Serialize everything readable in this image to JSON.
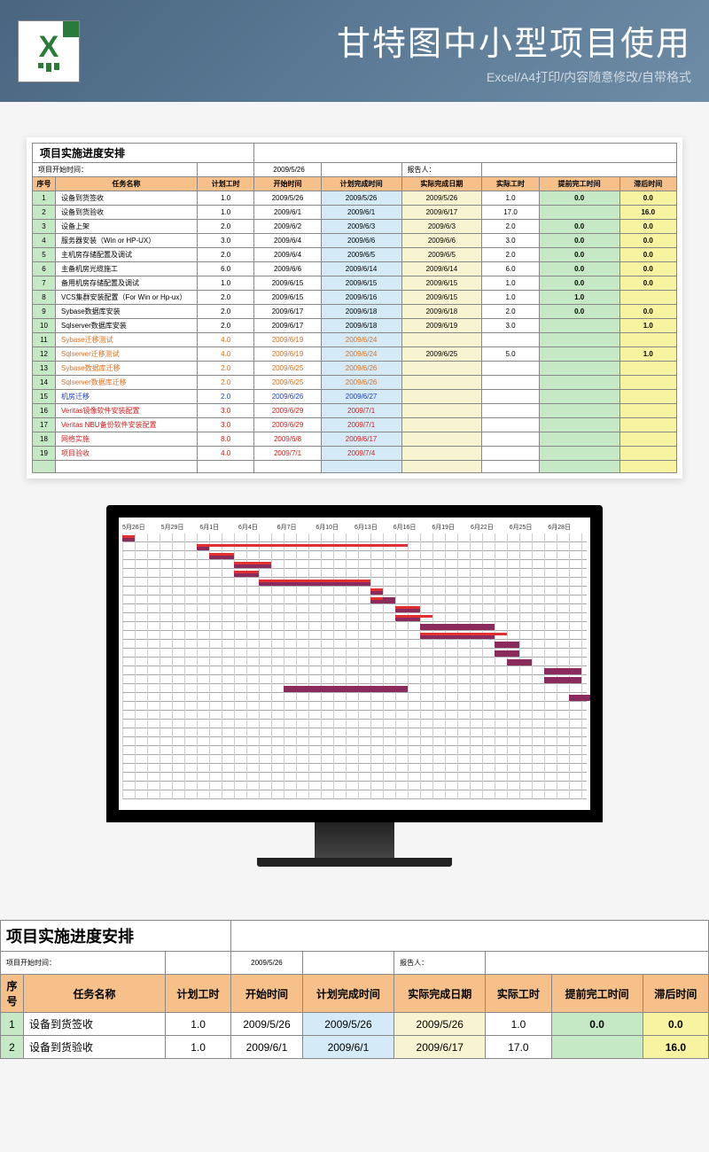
{
  "banner": {
    "title": "甘特图中小型项目使用",
    "subtitle": "Excel/A4打印/内容随意修改/自带格式"
  },
  "sheet": {
    "title": "项目实施进度安排",
    "start_label": "项目开始时间：",
    "start_date": "2009/5/26",
    "reporter_label": "报告人：",
    "headers": {
      "seq": "序号",
      "name": "任务名称",
      "plan_hours": "计划工时",
      "start": "开始时间",
      "plan_end": "计划完成时间",
      "actual_end": "实际完成日期",
      "actual_hours": "实际工时",
      "early": "提前完工时间",
      "late": "滞后时间"
    },
    "rows": [
      {
        "seq": "1",
        "name": "设备到货签收",
        "ph": "1.0",
        "st": "2009/5/26",
        "pe": "2009/5/26",
        "ae": "2009/5/26",
        "ah": "1.0",
        "early": "0.0",
        "late": "0.0",
        "cls": ""
      },
      {
        "seq": "2",
        "name": "设备到货验收",
        "ph": "1.0",
        "st": "2009/6/1",
        "pe": "2009/6/1",
        "ae": "2009/6/17",
        "ah": "17.0",
        "early": "",
        "late": "16.0",
        "cls": ""
      },
      {
        "seq": "3",
        "name": "设备上架",
        "ph": "2.0",
        "st": "2009/6/2",
        "pe": "2009/6/3",
        "ae": "2009/6/3",
        "ah": "2.0",
        "early": "0.0",
        "late": "0.0",
        "cls": ""
      },
      {
        "seq": "4",
        "name": "服务器安装（Win or HP-UX）",
        "ph": "3.0",
        "st": "2009/6/4",
        "pe": "2009/6/6",
        "ae": "2009/6/6",
        "ah": "3.0",
        "early": "0.0",
        "late": "0.0",
        "cls": ""
      },
      {
        "seq": "5",
        "name": "主机房存储配置及调试",
        "ph": "2.0",
        "st": "2009/6/4",
        "pe": "2009/6/5",
        "ae": "2009/6/5",
        "ah": "2.0",
        "early": "0.0",
        "late": "0.0",
        "cls": ""
      },
      {
        "seq": "6",
        "name": "主备机房光缆施工",
        "ph": "6.0",
        "st": "2009/6/6",
        "pe": "2009/6/14",
        "ae": "2009/6/14",
        "ah": "6.0",
        "early": "0.0",
        "late": "0.0",
        "cls": ""
      },
      {
        "seq": "7",
        "name": "备用机房存储配置及调试",
        "ph": "1.0",
        "st": "2009/6/15",
        "pe": "2009/6/15",
        "ae": "2009/6/15",
        "ah": "1.0",
        "early": "0.0",
        "late": "0.0",
        "cls": ""
      },
      {
        "seq": "8",
        "name": "VCS集群安装配置（For Win or Hp-ux）",
        "ph": "2.0",
        "st": "2009/6/15",
        "pe": "2009/6/16",
        "ae": "2009/6/15",
        "ah": "1.0",
        "early": "1.0",
        "late": "",
        "cls": ""
      },
      {
        "seq": "9",
        "name": "Sybase数据库安装",
        "ph": "2.0",
        "st": "2009/6/17",
        "pe": "2009/6/18",
        "ae": "2009/6/18",
        "ah": "2.0",
        "early": "0.0",
        "late": "0.0",
        "cls": ""
      },
      {
        "seq": "10",
        "name": "Sqlserver数据库安装",
        "ph": "2.0",
        "st": "2009/6/17",
        "pe": "2009/6/18",
        "ae": "2009/6/19",
        "ah": "3.0",
        "early": "",
        "late": "1.0",
        "cls": ""
      },
      {
        "seq": "11",
        "name": "Sybase迁移测试",
        "ph": "4.0",
        "st": "2009/6/19",
        "pe": "2009/6/24",
        "ae": "",
        "ah": "",
        "early": "",
        "late": "",
        "cls": "txt-orange"
      },
      {
        "seq": "12",
        "name": "Sqlserver迁移测试",
        "ph": "4.0",
        "st": "2009/6/19",
        "pe": "2009/6/24",
        "ae": "2009/6/25",
        "ah": "5.0",
        "early": "",
        "late": "1.0",
        "cls": "txt-orange"
      },
      {
        "seq": "13",
        "name": "Sybase数据库迁移",
        "ph": "2.0",
        "st": "2009/6/25",
        "pe": "2009/6/26",
        "ae": "",
        "ah": "",
        "early": "",
        "late": "",
        "cls": "txt-orange"
      },
      {
        "seq": "14",
        "name": "Sqlserver数据库迁移",
        "ph": "2.0",
        "st": "2009/6/25",
        "pe": "2009/6/26",
        "ae": "",
        "ah": "",
        "early": "",
        "late": "",
        "cls": "txt-orange"
      },
      {
        "seq": "15",
        "name": "机房迁移",
        "ph": "2.0",
        "st": "2009/6/26",
        "pe": "2009/6/27",
        "ae": "",
        "ah": "",
        "early": "",
        "late": "",
        "cls": "txt-blue"
      },
      {
        "seq": "16",
        "name": "Veritas镜像软件安装配置",
        "ph": "3.0",
        "st": "2009/6/29",
        "pe": "2009/7/1",
        "ae": "",
        "ah": "",
        "early": "",
        "late": "",
        "cls": "txt-red"
      },
      {
        "seq": "17",
        "name": "Veritas NBU备份软件安装配置",
        "ph": "3.0",
        "st": "2009/6/29",
        "pe": "2009/7/1",
        "ae": "",
        "ah": "",
        "early": "",
        "late": "",
        "cls": "txt-red"
      },
      {
        "seq": "18",
        "name": "网络实施",
        "ph": "8.0",
        "st": "2009/6/8",
        "pe": "2009/6/17",
        "ae": "",
        "ah": "",
        "early": "",
        "late": "",
        "cls": "txt-red"
      },
      {
        "seq": "19",
        "name": "项目验收",
        "ph": "4.0",
        "st": "2009/7/1",
        "pe": "2009/7/4",
        "ae": "",
        "ah": "",
        "early": "",
        "late": "",
        "cls": "txt-red"
      }
    ]
  },
  "chart_data": {
    "type": "gantt",
    "title": "",
    "x_axis_dates": [
      "5月26日",
      "5月29日",
      "6月1日",
      "6月4日",
      "6月7日",
      "6月10日",
      "6月13日",
      "6月16日",
      "6月19日",
      "6月22日",
      "6月25日",
      "6月28日"
    ],
    "tasks": [
      {
        "row": 1,
        "plan_start": "2009/5/26",
        "plan_len": 1,
        "actual_start": "2009/5/26",
        "actual_len": 1
      },
      {
        "row": 2,
        "plan_start": "2009/6/1",
        "plan_len": 1,
        "actual_start": "2009/6/1",
        "actual_len": 17
      },
      {
        "row": 3,
        "plan_start": "2009/6/2",
        "plan_len": 2,
        "actual_start": "2009/6/2",
        "actual_len": 2
      },
      {
        "row": 4,
        "plan_start": "2009/6/4",
        "plan_len": 3,
        "actual_start": "2009/6/4",
        "actual_len": 3
      },
      {
        "row": 5,
        "plan_start": "2009/6/4",
        "plan_len": 2,
        "actual_start": "2009/6/4",
        "actual_len": 2
      },
      {
        "row": 6,
        "plan_start": "2009/6/6",
        "plan_len": 9,
        "actual_start": "2009/6/6",
        "actual_len": 9
      },
      {
        "row": 7,
        "plan_start": "2009/6/15",
        "plan_len": 1,
        "actual_start": "2009/6/15",
        "actual_len": 1
      },
      {
        "row": 8,
        "plan_start": "2009/6/15",
        "plan_len": 2,
        "actual_start": "2009/6/15",
        "actual_len": 1
      },
      {
        "row": 9,
        "plan_start": "2009/6/17",
        "plan_len": 2,
        "actual_start": "2009/6/17",
        "actual_len": 2
      },
      {
        "row": 10,
        "plan_start": "2009/6/17",
        "plan_len": 2,
        "actual_start": "2009/6/17",
        "actual_len": 3
      },
      {
        "row": 11,
        "plan_start": "2009/6/19",
        "plan_len": 6
      },
      {
        "row": 12,
        "plan_start": "2009/6/19",
        "plan_len": 6,
        "actual_start": "2009/6/19",
        "actual_len": 7
      },
      {
        "row": 13,
        "plan_start": "2009/6/25",
        "plan_len": 2
      },
      {
        "row": 14,
        "plan_start": "2009/6/25",
        "plan_len": 2
      },
      {
        "row": 15,
        "plan_start": "2009/6/26",
        "plan_len": 2
      },
      {
        "row": 16,
        "plan_start": "2009/6/29",
        "plan_len": 3
      },
      {
        "row": 17,
        "plan_start": "2009/6/29",
        "plan_len": 3
      },
      {
        "row": 18,
        "plan_start": "2009/6/8",
        "plan_len": 10
      },
      {
        "row": 19,
        "plan_start": "2009/7/1",
        "plan_len": 4
      }
    ]
  }
}
